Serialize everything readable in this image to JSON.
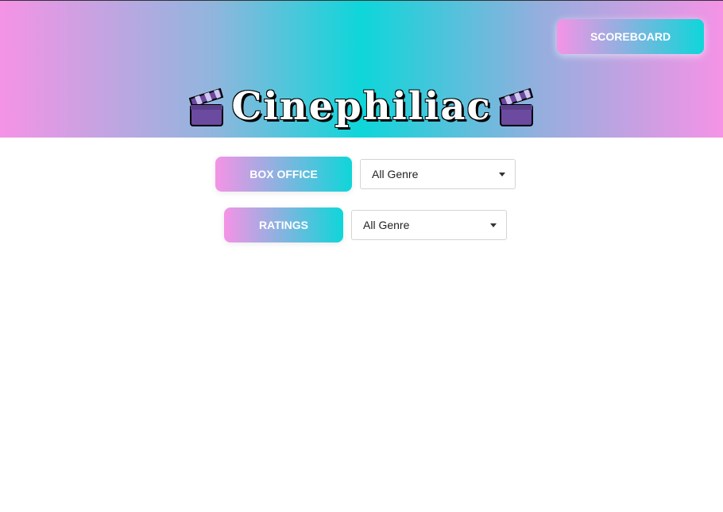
{
  "header": {
    "title": "Cinephiliac",
    "left_icon": "clapper-board-icon",
    "right_icon": "clapper-board-icon",
    "scoreboard_label": "SCOREBOARD"
  },
  "controls": {
    "box_office": {
      "label": "BOX OFFICE",
      "genre_value": "All Genre"
    },
    "ratings": {
      "label": "RATINGS",
      "genre_value": "All Genre"
    }
  },
  "colors": {
    "gradient_pink": "#f593e6",
    "gradient_cyan": "#0ed6d9",
    "button_text": "#ffffff"
  }
}
